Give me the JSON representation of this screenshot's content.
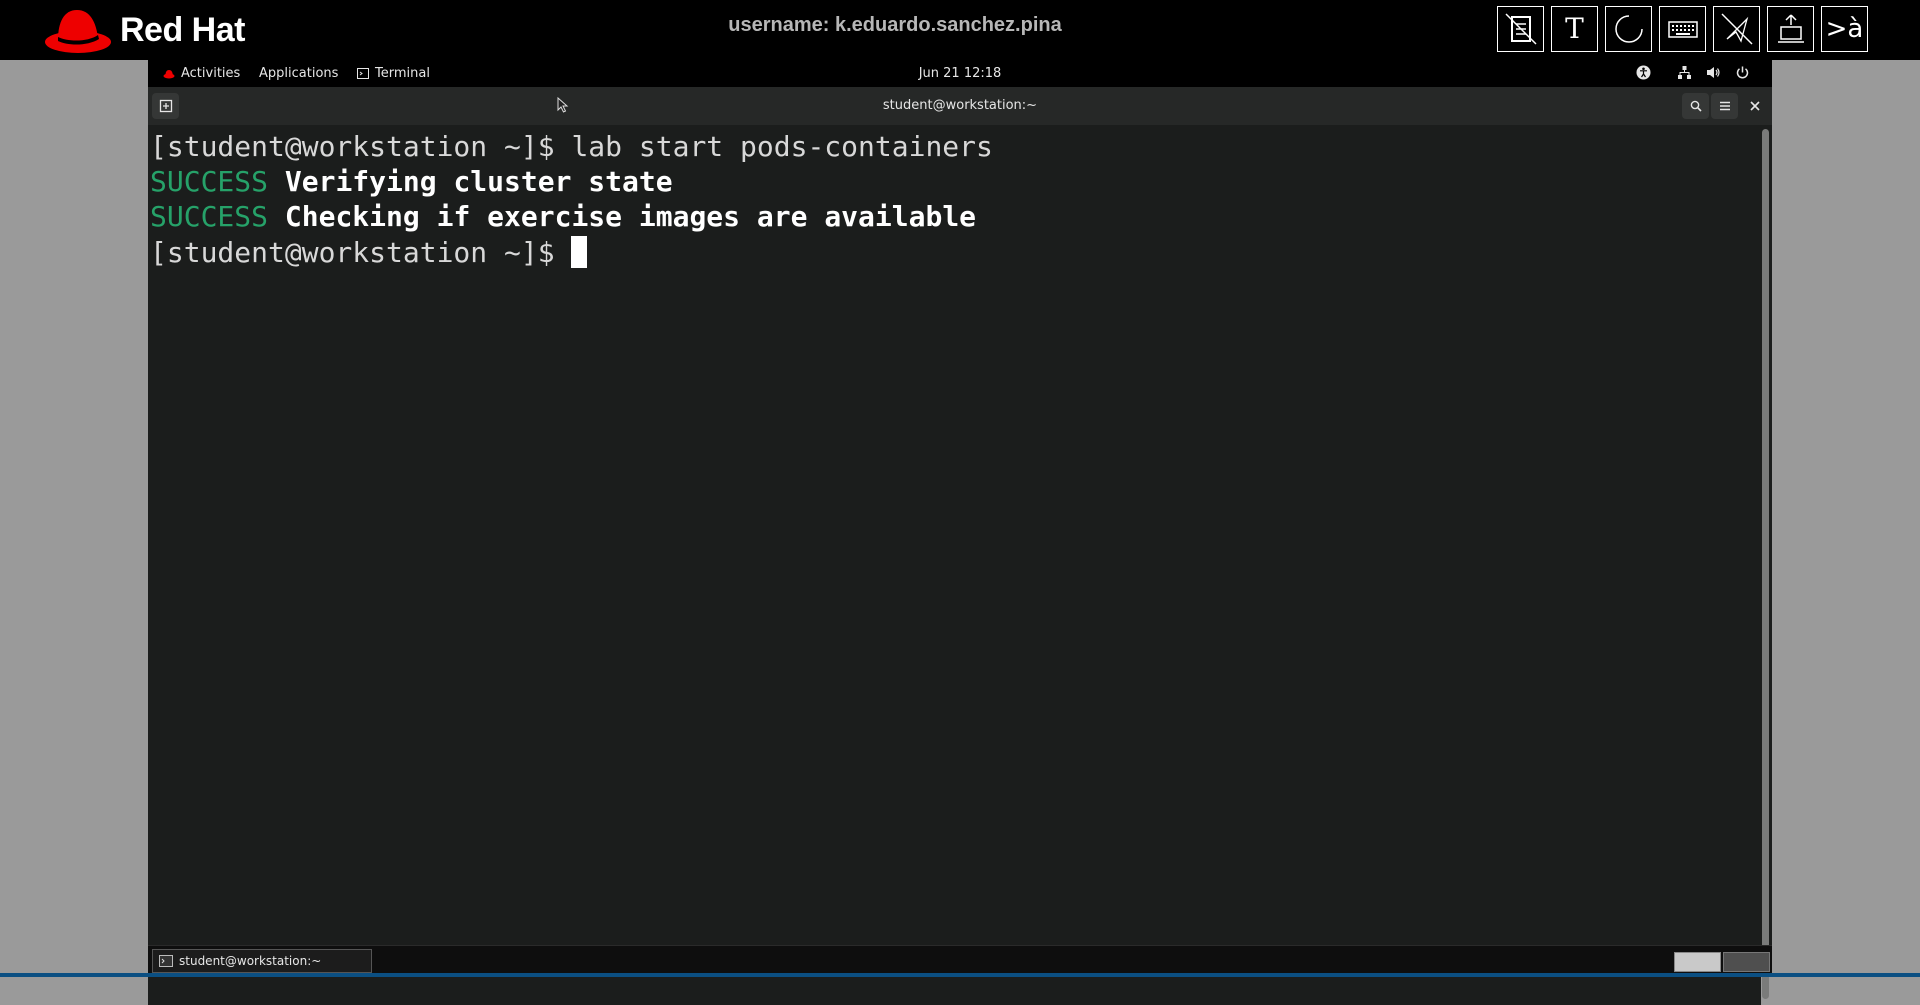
{
  "vnc_bar": {
    "logo_text": "Red Hat",
    "username": "username: k.eduardo.sanchez.pina",
    "tools": [
      {
        "name": "clipboard-disabled-icon"
      },
      {
        "name": "text-icon",
        "glyph": "T"
      },
      {
        "name": "refresh-icon"
      },
      {
        "name": "keyboard-icon"
      },
      {
        "name": "send-disabled-icon"
      },
      {
        "name": "upload-icon"
      },
      {
        "name": "language-icon",
        "glyph": ">à"
      }
    ],
    "brand_color": "#ee0000"
  },
  "gnome": {
    "activities": "Activities",
    "applications": "Applications",
    "terminal_app": "Terminal",
    "clock": "Jun 21  12:18"
  },
  "terminal": {
    "title": "student@workstation:~",
    "lines": [
      {
        "prompt": "[student@workstation ~]$ ",
        "command": "lab start pods-containers"
      },
      {
        "status": "SUCCESS",
        "message": "Verifying cluster state"
      },
      {
        "status": "SUCCESS",
        "message": "Checking if exercise images are available"
      },
      {
        "prompt": "[student@workstation ~]$ ",
        "command": ""
      }
    ],
    "success_color": "#26a269"
  },
  "taskbar": {
    "window_label": "student@workstation:~"
  }
}
